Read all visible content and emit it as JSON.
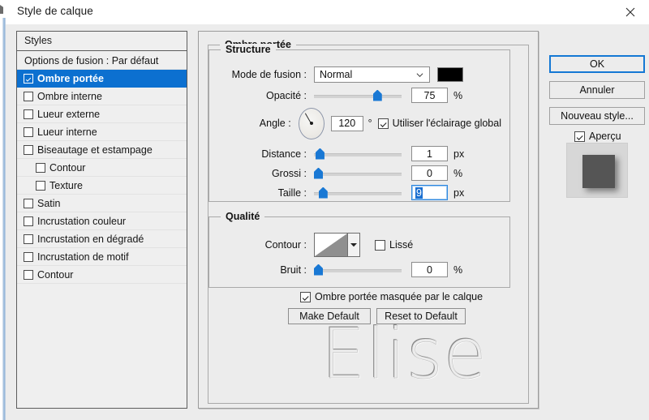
{
  "window": {
    "title": "Style de calque",
    "close_label": "✕"
  },
  "styles_panel": {
    "header": "Styles",
    "items": [
      {
        "label": "Options de fusion : Par défaut",
        "has_checkbox": false,
        "checked": false,
        "selected": false,
        "nested": false
      },
      {
        "label": "Ombre portée",
        "has_checkbox": true,
        "checked": true,
        "selected": true,
        "nested": false
      },
      {
        "label": "Ombre interne",
        "has_checkbox": true,
        "checked": false,
        "selected": false,
        "nested": false
      },
      {
        "label": "Lueur externe",
        "has_checkbox": true,
        "checked": false,
        "selected": false,
        "nested": false
      },
      {
        "label": "Lueur interne",
        "has_checkbox": true,
        "checked": false,
        "selected": false,
        "nested": false
      },
      {
        "label": "Biseautage et estampage",
        "has_checkbox": true,
        "checked": false,
        "selected": false,
        "nested": false
      },
      {
        "label": "Contour",
        "has_checkbox": true,
        "checked": false,
        "selected": false,
        "nested": true
      },
      {
        "label": "Texture",
        "has_checkbox": true,
        "checked": false,
        "selected": false,
        "nested": true
      },
      {
        "label": "Satin",
        "has_checkbox": true,
        "checked": false,
        "selected": false,
        "nested": false
      },
      {
        "label": "Incrustation couleur",
        "has_checkbox": true,
        "checked": false,
        "selected": false,
        "nested": false
      },
      {
        "label": "Incrustation en dégradé",
        "has_checkbox": true,
        "checked": false,
        "selected": false,
        "nested": false
      },
      {
        "label": "Incrustation de motif",
        "has_checkbox": true,
        "checked": false,
        "selected": false,
        "nested": false
      },
      {
        "label": "Contour",
        "has_checkbox": true,
        "checked": false,
        "selected": false,
        "nested": false
      }
    ]
  },
  "options": {
    "group_title": "Ombre portée",
    "structure": {
      "title": "Structure",
      "blend_mode": {
        "label": "Mode de fusion :",
        "value": "Normal",
        "color": "#000000"
      },
      "opacity": {
        "label": "Opacité :",
        "value": "75",
        "unit": "%",
        "slider_percent": 75
      },
      "angle": {
        "label": "Angle :",
        "value": "120",
        "unit": "°",
        "degrees": 120
      },
      "global_light": {
        "label": "Utiliser l'éclairage global",
        "checked": true
      },
      "distance": {
        "label": "Distance :",
        "value": "1",
        "unit": "px",
        "slider_percent": 2
      },
      "spread": {
        "label": "Grossi :",
        "value": "0",
        "unit": "%",
        "slider_percent": 0
      },
      "size": {
        "label": "Taille :",
        "value": "9",
        "unit": "px",
        "slider_percent": 6,
        "focused": true
      }
    },
    "quality": {
      "title": "Qualité",
      "contour": {
        "label": "Contour :"
      },
      "anti_alias": {
        "label": "Lissé",
        "checked": false
      },
      "noise": {
        "label": "Bruit :",
        "value": "0",
        "unit": "%",
        "slider_percent": 0
      }
    },
    "knockout": {
      "label": "Ombre portée masquée par le calque",
      "checked": true
    },
    "make_default": "Make Default",
    "reset_default": "Reset to Default"
  },
  "side": {
    "ok": "OK",
    "cancel": "Annuler",
    "new_style": "Nouveau style...",
    "preview": {
      "label": "Aperçu",
      "checked": true
    }
  },
  "watermark": {
    "text": "Elise"
  },
  "colors": {
    "accent": "#0c70d0",
    "slider_thumb": "#1978d4",
    "dialog_bg": "#ececec",
    "swatch": "#000000"
  }
}
